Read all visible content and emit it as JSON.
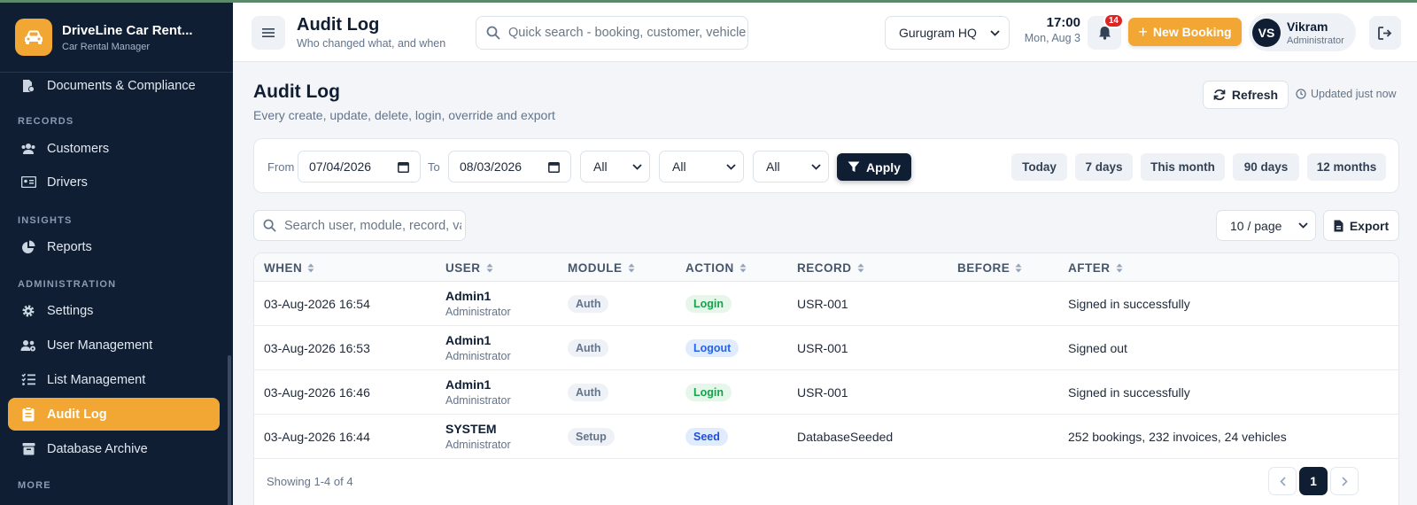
{
  "app": {
    "name": "DriveLine Car Rent...",
    "subtitle": "Car Rental Manager",
    "accent": "#f2a633",
    "sidebar_bg": "#0f1e33"
  },
  "sidebar": {
    "items": [
      {
        "label": "Documents & Compliance",
        "icon": "documents-icon"
      },
      {
        "label": "Customers",
        "icon": "users-icon"
      },
      {
        "label": "Drivers",
        "icon": "id-card-icon"
      },
      {
        "label": "Reports",
        "icon": "pie-chart-icon"
      },
      {
        "label": "Settings",
        "icon": "gear-icon"
      },
      {
        "label": "User Management",
        "icon": "users-cog-icon"
      },
      {
        "label": "List Management",
        "icon": "list-check-icon"
      },
      {
        "label": "Audit Log",
        "icon": "clipboard-icon",
        "active": true
      },
      {
        "label": "Database Archive",
        "icon": "archive-icon"
      }
    ],
    "sections": {
      "records": "RECORDS",
      "insights": "INSIGHTS",
      "administration": "ADMINISTRATION",
      "more": "MORE"
    }
  },
  "header": {
    "title": "Audit Log",
    "subtitle": "Who changed what, and when",
    "search_placeholder": "Quick search - booking, customer, vehicle",
    "branch": "Gurugram HQ",
    "time": "17:00",
    "date": "Mon, Aug 3",
    "notifications": "14",
    "new_booking": "New Booking",
    "user_initials": "VS",
    "user_name": "Vikram",
    "user_role": "Administrator"
  },
  "main": {
    "title": "Audit Log",
    "subtitle": "Every create, update, delete, login, override and export",
    "refresh": "Refresh",
    "updated": "Updated just now",
    "filters": {
      "from_label": "From",
      "from_value": "07/04/2026",
      "to_label": "To",
      "to_value": "08/03/2026",
      "select1": "All",
      "select2": "All",
      "select3": "All",
      "apply": "Apply",
      "quick": [
        "Today",
        "7 days",
        "This month",
        "90 days",
        "12 months"
      ]
    },
    "table_search_placeholder": "Search user, module, record, value",
    "per_page": "10 / page",
    "export": "Export",
    "columns": [
      "WHEN",
      "USER",
      "MODULE",
      "ACTION",
      "RECORD",
      "BEFORE",
      "AFTER"
    ],
    "rows": [
      {
        "when": "03-Aug-2026 16:54",
        "user": "Admin1",
        "role": "Administrator",
        "module": "Auth",
        "action": "Login",
        "record": "USR-001",
        "before": "",
        "after": "Signed in successfully"
      },
      {
        "when": "03-Aug-2026 16:53",
        "user": "Admin1",
        "role": "Administrator",
        "module": "Auth",
        "action": "Logout",
        "record": "USR-001",
        "before": "",
        "after": "Signed out"
      },
      {
        "when": "03-Aug-2026 16:46",
        "user": "Admin1",
        "role": "Administrator",
        "module": "Auth",
        "action": "Login",
        "record": "USR-001",
        "before": "",
        "after": "Signed in successfully"
      },
      {
        "when": "03-Aug-2026 16:44",
        "user": "SYSTEM",
        "role": "Administrator",
        "module": "Setup",
        "action": "Seed",
        "record": "DatabaseSeeded",
        "before": "",
        "after": "252 bookings, 232 invoices, 24 vehicles"
      }
    ],
    "showing": "Showing 1-4 of 4",
    "page": "1"
  }
}
